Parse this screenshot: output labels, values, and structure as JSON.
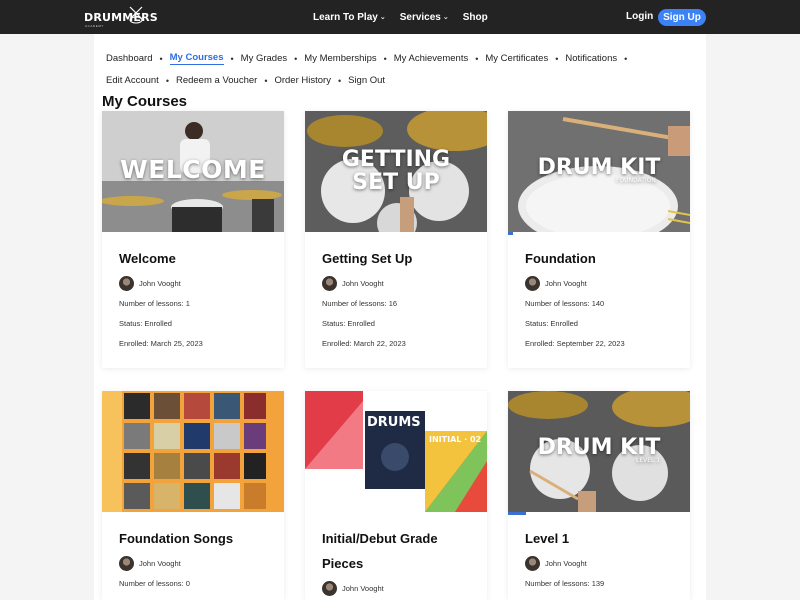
{
  "header": {
    "logo_text": "DRUMMERS",
    "logo_subtext": "ACADEMY",
    "nav": [
      {
        "label": "Learn To Play",
        "has_dropdown": true
      },
      {
        "label": "Services",
        "has_dropdown": true
      },
      {
        "label": "Shop",
        "has_dropdown": false
      }
    ],
    "login_label": "Login",
    "signup_label": "Sign Up"
  },
  "subnav": {
    "row1": [
      "Dashboard",
      "My Courses",
      "My Grades",
      "My Memberships",
      "My Achievements",
      "My Certificates",
      "Notifications"
    ],
    "row2": [
      "Edit Account",
      "Redeem a Voucher",
      "Order History",
      "Sign Out"
    ],
    "active": "My Courses"
  },
  "page_title": "My Courses",
  "courses": [
    {
      "title": "Welcome",
      "thumb_text": "WELCOME",
      "thumb_sub": "",
      "author": "John Vooght",
      "lessons": "Number of lessons: 1",
      "status": "Status: Enrolled",
      "enrolled": "Enrolled: March 25, 2023",
      "progress": 0
    },
    {
      "title": "Getting Set Up",
      "thumb_text": "GETTING SET UP",
      "thumb_sub": "",
      "author": "John Vooght",
      "lessons": "Number of lessons: 16",
      "status": "Status: Enrolled",
      "enrolled": "Enrolled: March 22, 2023",
      "progress": 0
    },
    {
      "title": "Foundation",
      "thumb_text": "DRUM KIT",
      "thumb_sub": "FOUNDATION",
      "author": "John Vooght",
      "lessons": "Number of lessons: 140",
      "status": "Status: Enrolled",
      "enrolled": "Enrolled: September 22, 2023",
      "progress": 0.03
    },
    {
      "title": "Foundation Songs",
      "thumb_text": "",
      "thumb_sub": "",
      "author": "John Vooght",
      "lessons": "Number of lessons: 0",
      "status": "",
      "enrolled": "",
      "progress": 0
    },
    {
      "title": "Initial/Debut Grade Pieces",
      "thumb_text": "DRUMS",
      "thumb_sub": "INITIAL · 02",
      "author": "John Vooght",
      "lessons": "",
      "status": "",
      "enrolled": "",
      "progress": 0
    },
    {
      "title": "Level 1",
      "thumb_text": "DRUM KIT",
      "thumb_sub": "LEVEL 1",
      "author": "John Vooght",
      "lessons": "Number of lessons: 139",
      "status": "",
      "enrolled": "",
      "progress": 0.1
    }
  ],
  "colors": {
    "accent": "#3b82f6",
    "active_link": "#2f6fe0",
    "header_bg": "#232323",
    "progress": "#3b6fd6"
  }
}
